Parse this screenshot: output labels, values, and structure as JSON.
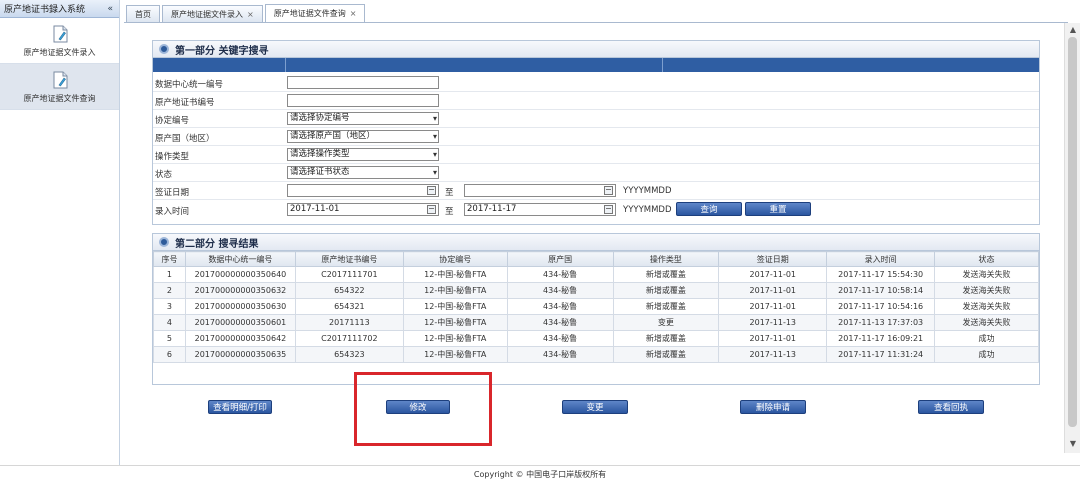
{
  "sidebar": {
    "title": "原产地证书録入系统",
    "collapse_glyph": "«",
    "items": [
      {
        "label": "原产地证据文件录入"
      },
      {
        "label": "原产地证据文件查询"
      }
    ]
  },
  "tabs": [
    {
      "label": "首页"
    },
    {
      "label": "原产地证据文件录入",
      "close": "×"
    },
    {
      "label": "原产地证据文件查询",
      "close": "×"
    }
  ],
  "search": {
    "section_title": "第一部分 关键字搜寻",
    "fields": {
      "center_id": {
        "label": "数据中心统一编号",
        "value": ""
      },
      "cert_no": {
        "label": "原产地证书编号",
        "value": ""
      },
      "agreement": {
        "label": "协定编号",
        "value": "请选择协定编号"
      },
      "country": {
        "label": "原产国（地区）",
        "value": "请选择原产国（地区）"
      },
      "op_type": {
        "label": "操作类型",
        "value": "请选择操作类型"
      },
      "status": {
        "label": "状态",
        "value": "请选择证书状态"
      },
      "issue_date": {
        "label": "签证日期",
        "from": "",
        "to": ""
      },
      "entry_time": {
        "label": "录入时间",
        "from": "2017-11-01",
        "to": "2017-11-17"
      }
    },
    "to_label": "至",
    "date_format": "YYYYMMDD",
    "query_button": "查询",
    "reset_button": "重置"
  },
  "results": {
    "section_title": "第二部分 搜寻结果",
    "columns": [
      "序号",
      "数据中心统一编号",
      "原产地证书编号",
      "协定编号",
      "原产国",
      "操作类型",
      "签证日期",
      "录入时间",
      "状态"
    ],
    "rows": [
      [
        "1",
        "201700000000350640",
        "C2017111701",
        "12-中国-秘鲁FTA",
        "434-秘鲁",
        "新增或覆盖",
        "2017-11-01",
        "2017-11-17 15:54:30",
        "发送海关失败"
      ],
      [
        "2",
        "201700000000350632",
        "654322",
        "12-中国-秘鲁FTA",
        "434-秘鲁",
        "新增或覆盖",
        "2017-11-01",
        "2017-11-17 10:58:14",
        "发送海关失败"
      ],
      [
        "3",
        "201700000000350630",
        "654321",
        "12-中国-秘鲁FTA",
        "434-秘鲁",
        "新增或覆盖",
        "2017-11-01",
        "2017-11-17 10:54:16",
        "发送海关失败"
      ],
      [
        "4",
        "201700000000350601",
        "20171113",
        "12-中国-秘鲁FTA",
        "434-秘鲁",
        "变更",
        "2017-11-13",
        "2017-11-13 17:37:03",
        "发送海关失败"
      ],
      [
        "5",
        "201700000000350642",
        "C2017111702",
        "12-中国-秘鲁FTA",
        "434-秘鲁",
        "新增或覆盖",
        "2017-11-01",
        "2017-11-17 16:09:21",
        "成功"
      ],
      [
        "6",
        "201700000000350635",
        "654323",
        "12-中国-秘鲁FTA",
        "434-秘鲁",
        "新增或覆盖",
        "2017-11-13",
        "2017-11-17 11:31:24",
        "成功"
      ]
    ]
  },
  "actions": {
    "view_print": "查看明细/打印",
    "modify": "修改",
    "change": "变更",
    "delete_request": "删除申请",
    "view_receipt": "查看回执"
  },
  "scroll": {
    "up": "▲",
    "down": "▼"
  },
  "footer": {
    "copyright": "Copyright © 中国电子口岸版权所有"
  },
  "colors": {
    "title_strip": "#2f5ea3",
    "highlight": "#d9262b"
  }
}
